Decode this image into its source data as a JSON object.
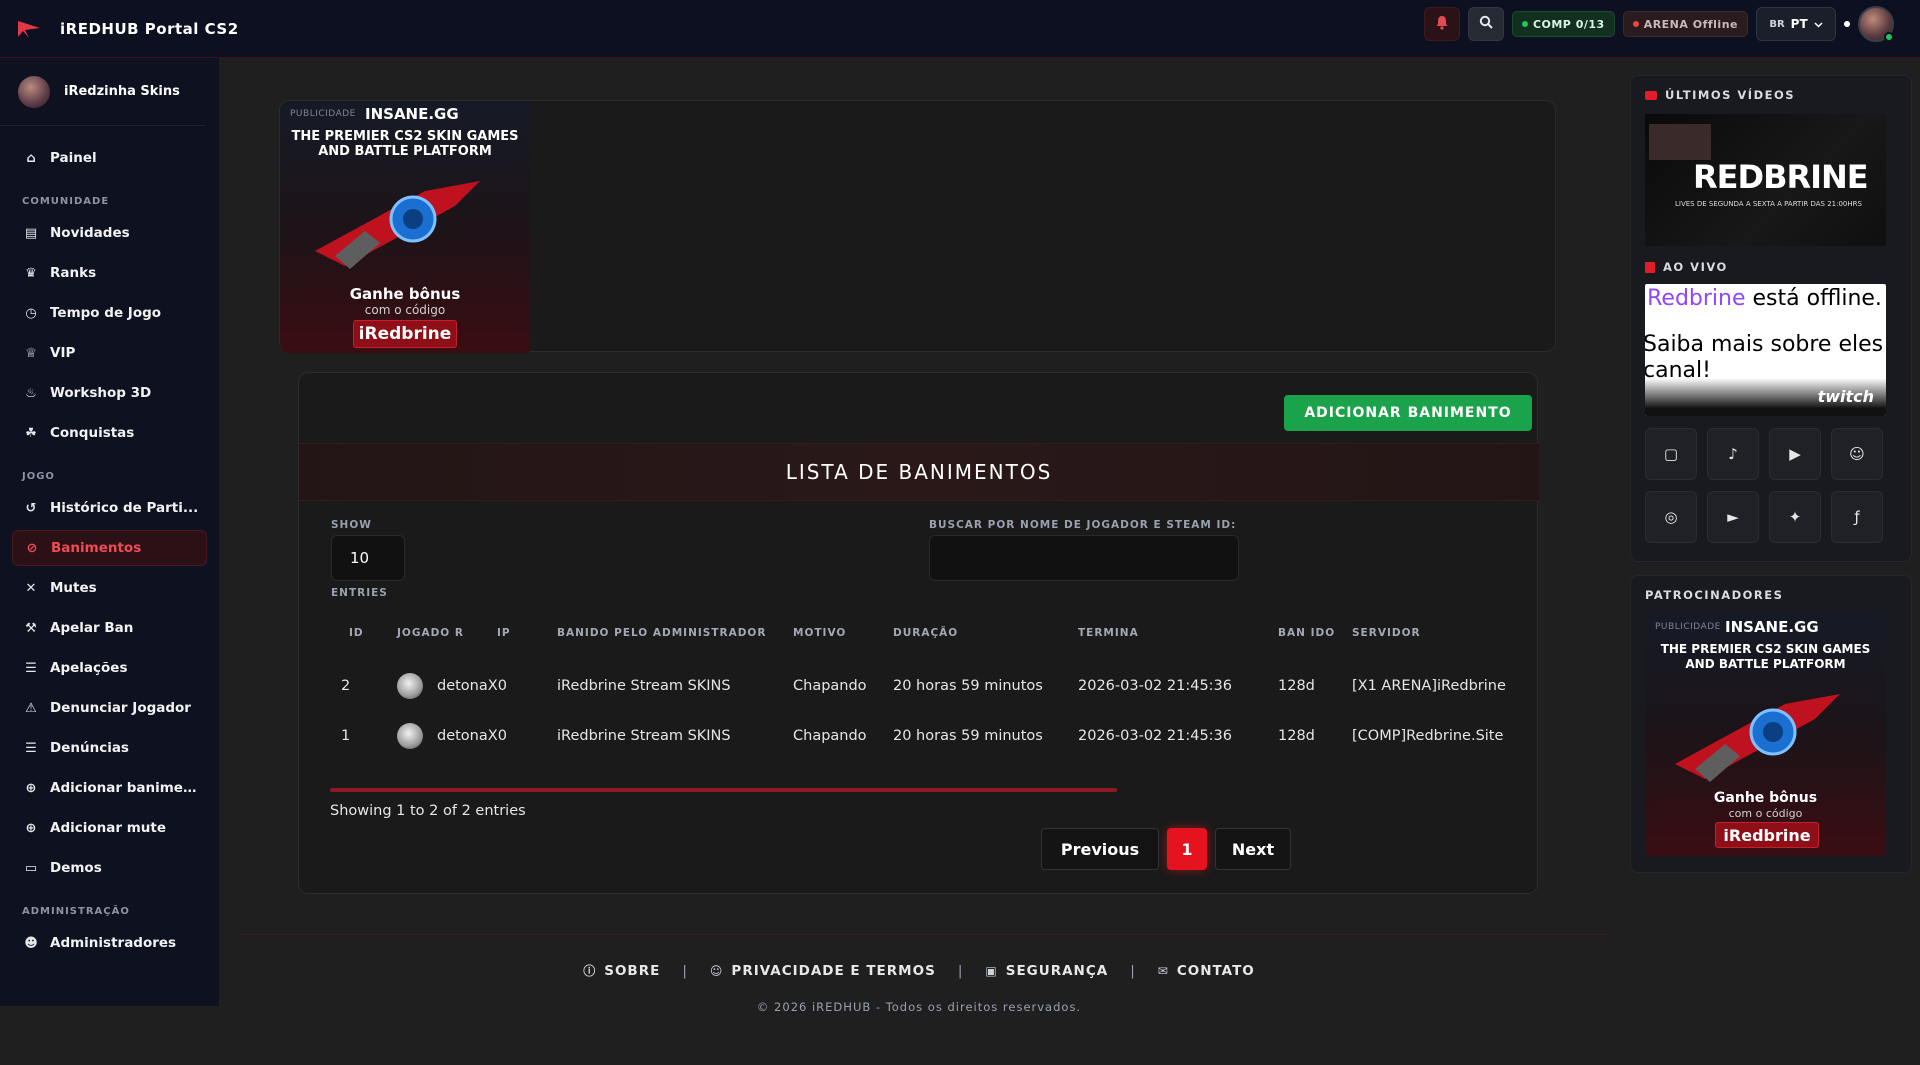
{
  "app": {
    "title": "iREDHUB  Portal CS2"
  },
  "topbar": {
    "comp_label": "COMP 0/13",
    "arena_label": "ARENA Offline",
    "lang_flag": "BR",
    "lang_code": "PT",
    "icons": [
      "bell-icon",
      "search-icon",
      "chevron-down-icon"
    ]
  },
  "sidebar": {
    "profile_name": "iRedzinha Skins",
    "painel": "Painel",
    "section_comunidade": "COMUNIDADE",
    "comunidade": [
      {
        "label": "Novidades",
        "icon": "newspaper-icon"
      },
      {
        "label": "Ranks",
        "icon": "trophy-icon"
      },
      {
        "label": "Tempo de Jogo",
        "icon": "clock-icon"
      },
      {
        "label": "VIP",
        "icon": "crown-icon"
      },
      {
        "label": "Workshop 3D",
        "icon": "fire-icon"
      },
      {
        "label": "Conquistas",
        "icon": "medal-icon"
      }
    ],
    "section_jogo": "JOGO",
    "jogo": [
      {
        "label": "Histórico de Parti...",
        "icon": "history-icon"
      },
      {
        "label": "Banimentos",
        "icon": "ban-icon"
      },
      {
        "label": "Mutes",
        "icon": "microphone-slash-icon"
      },
      {
        "label": "Apelar Ban",
        "icon": "gavel-icon"
      },
      {
        "label": "Apelações",
        "icon": "list-icon"
      },
      {
        "label": "Denunciar Jogador",
        "icon": "user-slash-icon"
      },
      {
        "label": "Denúncias",
        "icon": "list-icon"
      },
      {
        "label": "Adicionar banimen...",
        "icon": "plus-circle-icon"
      },
      {
        "label": "Adicionar mute",
        "icon": "plus-circle-icon"
      },
      {
        "label": "Demos",
        "icon": "monitor-icon"
      }
    ],
    "section_admin": "ADMINISTRAÇÃO",
    "admin": [
      {
        "label": "Administradores",
        "icon": "users-cog-icon"
      }
    ]
  },
  "ad": {
    "tag": "PUBLICIDADE",
    "logo": "INSANE.GG",
    "headline_1": "THE PREMIER CS2 SKIN GAMES",
    "headline_2": "AND BATTLE PLATFORM",
    "bonus": "Ganhe bônus",
    "code_text": "com o código",
    "code": "iRedbrine"
  },
  "bans": {
    "add_button": "ADICIONAR BANIMENTO",
    "title": "LISTA DE BANIMENTOS",
    "show_label": "SHOW",
    "show_value": "10",
    "entries_label": "ENTRIES",
    "search_label": "BUSCAR POR NOME DE JOGADOR E STEAM ID:",
    "search_value": "",
    "columns": [
      "ID",
      "JOGADO R",
      "IP",
      "BANIDO PELO ADMINISTRADOR",
      "MOTIVO",
      "DURAÇÃO",
      "TERMINA",
      "BAN IDO",
      "SERVIDOR"
    ],
    "rows": [
      {
        "id": "2",
        "player": "detonaX0",
        "ip": "",
        "admin": "iRedbrine Stream SKINS",
        "motivo": "Chapando",
        "duracao": "20 horas 59 minutos",
        "termina": "2026-03-02 21:45:36",
        "banido": "128d",
        "servidor": "[X1 ARENA]iRedbrine"
      },
      {
        "id": "1",
        "player": "detonaX0",
        "ip": "",
        "admin": "iRedbrine Stream SKINS",
        "motivo": "Chapando",
        "duracao": "20 horas 59 minutos",
        "termina": "2026-03-02 21:45:36",
        "banido": "128d",
        "servidor": "[COMP]Redbrine.Site"
      }
    ],
    "showing": "Showing 1 to 2 of 2 entries",
    "prev": "Previous",
    "page": "1",
    "next": "Next"
  },
  "footer": {
    "links": [
      "SOBRE",
      "PRIVACIDADE E TERMOS",
      "SEGURANÇA",
      "CONTATO"
    ],
    "copyright": "© 2026 iREDHUB - Todos os direitos reservados."
  },
  "right": {
    "videos_title": "ÚLTIMOS VÍDEOS",
    "video_big": "REDBRINE",
    "video_sub": "LIVES DE SEGUNDA A SEXTA A PARTIR DAS 21:00HRS",
    "live_title": "AO VIVO",
    "live_name": "iRedbrine",
    "live_status": " está offline.",
    "live_more": "Saiba mais sobre eles no",
    "live_more2": "canal!",
    "twitch": "twitch",
    "socials": [
      "twitch-icon",
      "tiktok-icon",
      "youtube-icon",
      "discord-icon",
      "instagram-icon",
      "play-icon",
      "twitter-icon",
      "facebook-icon"
    ],
    "sponsors_title": "PATROCINADORES"
  },
  "colors": {
    "accent_red": "#e5131f",
    "accent_green": "#1aa34a",
    "sidebar_bg": "#0d1120",
    "page_bg": "#1f1f1f"
  }
}
